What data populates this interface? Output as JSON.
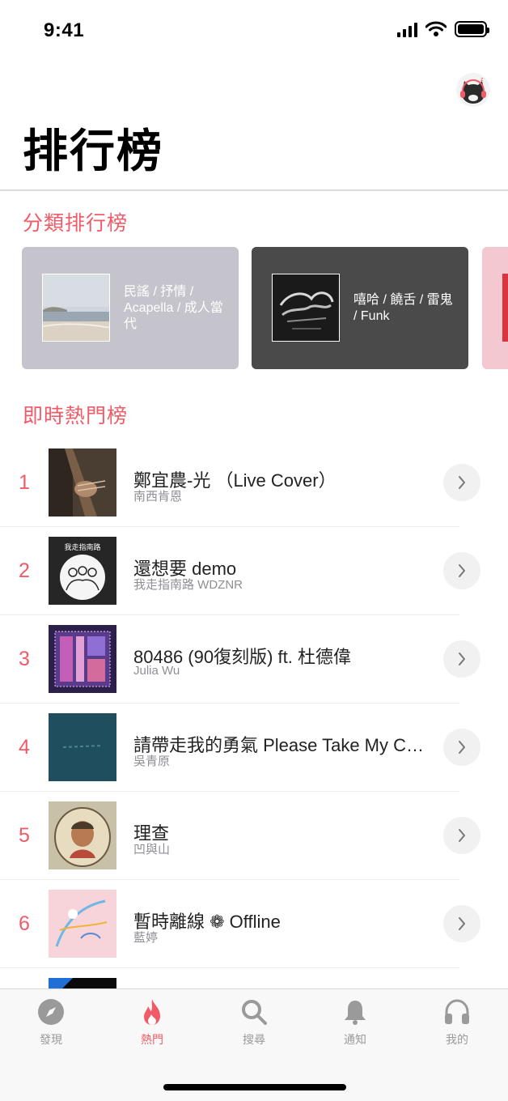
{
  "status_bar": {
    "time": "9:41"
  },
  "header": {
    "title": "排行榜",
    "avatar_icon": "cat-avatar-icon"
  },
  "categories": {
    "title": "分類排行榜",
    "cards": [
      {
        "label": "民謠 / 抒情 / Acapella / 成人當代"
      },
      {
        "label": "嘻哈 / 饒舌 / 雷鬼 / Funk"
      }
    ]
  },
  "hot": {
    "title": "即時熱門榜",
    "items": [
      {
        "rank": "1",
        "title": "鄭宜農-光 （Live Cover）",
        "artist": "南西肯恩"
      },
      {
        "rank": "2",
        "title": "還想要 demo",
        "artist": "我走指南路 WDZNR",
        "cover_text": "我走指南路"
      },
      {
        "rank": "3",
        "title": "80486 (90復刻版) ft. 杜德偉",
        "artist": "Julia Wu"
      },
      {
        "rank": "4",
        "title": "請帶走我的勇氣 Please Take My Courage Away",
        "artist": "吳青原"
      },
      {
        "rank": "5",
        "title": "理查",
        "artist": "凹與山"
      },
      {
        "rank": "6",
        "title": "暫時離線 ❁ Offline",
        "artist": "藍婷"
      }
    ]
  },
  "tab_bar": {
    "tabs": [
      {
        "label": "發現",
        "icon": "compass-icon"
      },
      {
        "label": "熱門",
        "icon": "flame-icon",
        "active": true
      },
      {
        "label": "搜尋",
        "icon": "search-icon"
      },
      {
        "label": "通知",
        "icon": "bell-icon"
      },
      {
        "label": "我的",
        "icon": "headphones-icon"
      }
    ]
  },
  "colors": {
    "accent": "#f15a67",
    "card_folk": "#c5c3cc",
    "card_hiphop": "#4a4a4a",
    "card_third": "#f4c8d0"
  }
}
